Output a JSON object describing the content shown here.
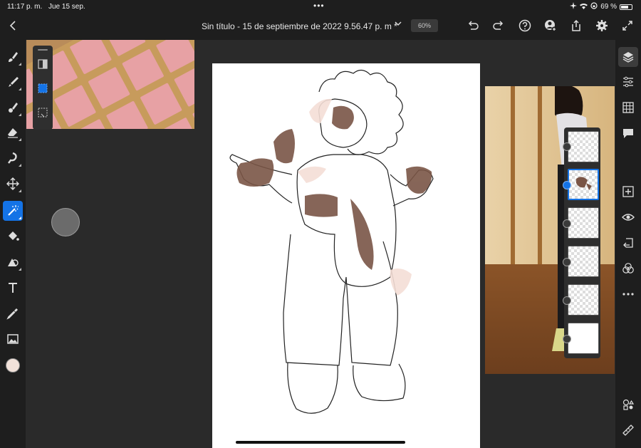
{
  "status_bar": {
    "time": "11:17 p. m.",
    "date": "Jue 15 sep.",
    "multitask_dots": "•••",
    "battery_text": "69 %"
  },
  "top_bar": {
    "document_title": "Sin título - 15 de septiembre de 2022 9.56.47 p. m *",
    "zoom_level": "60%",
    "icons": [
      "back-icon",
      "chevron-down-icon",
      "undo-icon",
      "redo-icon",
      "help-icon",
      "add-user-icon",
      "share-icon",
      "gear-icon",
      "fullscreen-icon"
    ]
  },
  "left_toolbar": {
    "tools": [
      "brush",
      "smudge-brush",
      "mixer-brush",
      "eraser",
      "liquify",
      "move",
      "magic-wand",
      "paint-bucket",
      "shape",
      "text",
      "eyedropper",
      "image"
    ],
    "active_tool": "magic-wand",
    "current_color": "#f2e2da"
  },
  "selection_palette": {
    "buttons": [
      "invert-selection",
      "select-subject",
      "deselect"
    ]
  },
  "layers_panel": {
    "layer_count": 6,
    "selected_index": 1
  },
  "right_toolbar": {
    "tools": [
      "layers",
      "adjustments",
      "grid",
      "comments",
      "add-layer",
      "visibility",
      "import",
      "blend",
      "more",
      "shapes",
      "ruler"
    ],
    "active_tool": "layers"
  },
  "colors": {
    "accent": "#1473e6",
    "chrome": "#1e1e1e",
    "workspace": "#2a2a2a"
  }
}
